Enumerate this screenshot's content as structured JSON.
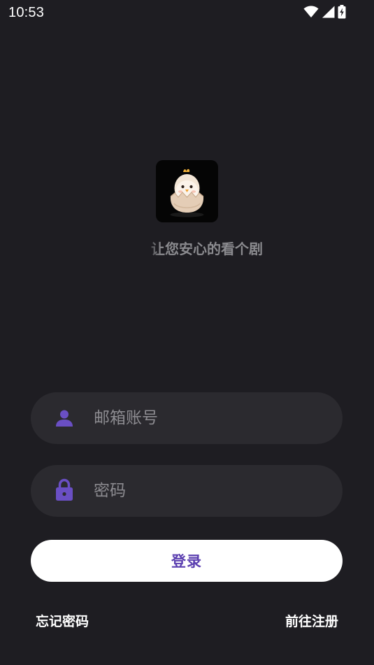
{
  "status_bar": {
    "time": "10:53",
    "icons": [
      "wifi-icon",
      "cell-signal-icon",
      "battery-charging-icon"
    ]
  },
  "app": {
    "logo_icon": "chick-in-egg-icon",
    "slogan": "让您安心的看个剧"
  },
  "form": {
    "email": {
      "icon": "person-icon",
      "placeholder": "邮箱账号",
      "value": ""
    },
    "password": {
      "icon": "lock-icon",
      "placeholder": "密码",
      "value": ""
    },
    "login_label": "登录"
  },
  "links": {
    "forgot_password": "忘记密码",
    "register": "前往注册"
  },
  "colors": {
    "background": "#1e1d22",
    "field_background": "#2b2a2f",
    "accent": "#6a4fc4",
    "button_text": "#5b3fb0",
    "placeholder": "#8d8c91"
  }
}
